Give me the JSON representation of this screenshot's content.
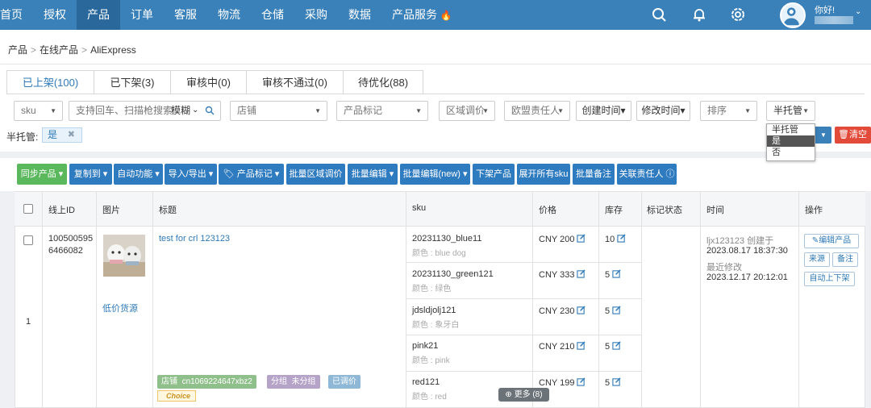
{
  "nav": {
    "items": [
      "首页",
      "授权",
      "产品",
      "订单",
      "客服",
      "物流",
      "仓储",
      "采购",
      "数据",
      "产品服务"
    ],
    "greeting": "你好!",
    "colors": {
      "bar": "#3a81b9",
      "active": "#2a679a"
    }
  },
  "breadcrumb": [
    "产品",
    "在线产品",
    "AliExpress"
  ],
  "tabs": [
    "已上架(100)",
    "已下架(3)",
    "审核中(0)",
    "审核不通过(0)",
    "待优化(88)"
  ],
  "filters": {
    "sku": "sku",
    "search_placeholder": "支持回车、扫描枪搜索",
    "match": "模糊",
    "store": "店铺",
    "product_tag": "产品标记",
    "region_price": "区域调价",
    "eu_person": "欧盟责任人",
    "created": "创建时间",
    "modified": "修改时间",
    "sort": "排序",
    "semi": "半托管",
    "active_label": "半托管:",
    "active_value": "是",
    "clear": "清空"
  },
  "semi_dropdown": [
    "半托管",
    "是",
    "否"
  ],
  "actions": [
    "同步产品",
    "复制到",
    "自动功能",
    "导入/导出",
    "产品标记",
    "批量区域调价",
    "批量编辑",
    "批量编辑(new)",
    "下架产品",
    "展开所有sku",
    "批量备注",
    "关联责任人"
  ],
  "table": {
    "headers": [
      "线上ID",
      "图片",
      "标题",
      "sku",
      "价格",
      "库存",
      "标记状态",
      "时间",
      "操作"
    ],
    "row": {
      "index": "1",
      "online_id_line1": "100500595",
      "online_id_line2": "6466082",
      "title": "test for crl 123123",
      "low_price": "低价货源",
      "skus": [
        {
          "code": "20231130_blue11",
          "color": "颜色 : blue dog",
          "currency": "CNY",
          "price": "200",
          "stock": "10"
        },
        {
          "code": "20231130_green121",
          "color": "颜色 : 绿色",
          "currency": "CNY",
          "price": "333",
          "stock": "5"
        },
        {
          "code": "jdsldjolj121",
          "color": "颜色 : 象牙白",
          "currency": "CNY",
          "price": "230",
          "stock": "5"
        },
        {
          "code": "pink21",
          "color": "颜色 : pink",
          "currency": "CNY",
          "price": "210",
          "stock": "5"
        },
        {
          "code": "red121",
          "color": "颜色 : red",
          "currency": "CNY",
          "price": "199",
          "stock": "5"
        }
      ],
      "time": {
        "creator": "ljx123123 创建于",
        "created": "2023.08.17 18:37:30",
        "modified_label": "最近修改",
        "modified": "2023.12.17 20:12:01"
      },
      "ops": [
        "编辑产品",
        "来源",
        "备注",
        "自动上下架"
      ],
      "tags": {
        "store_label": "店铺",
        "store_value": "cn1069224647xbz2",
        "group_label": "分组",
        "group_value": "未分组",
        "adjusted": "已调价",
        "choice": "Choice"
      },
      "more": "更多 (8)"
    }
  }
}
